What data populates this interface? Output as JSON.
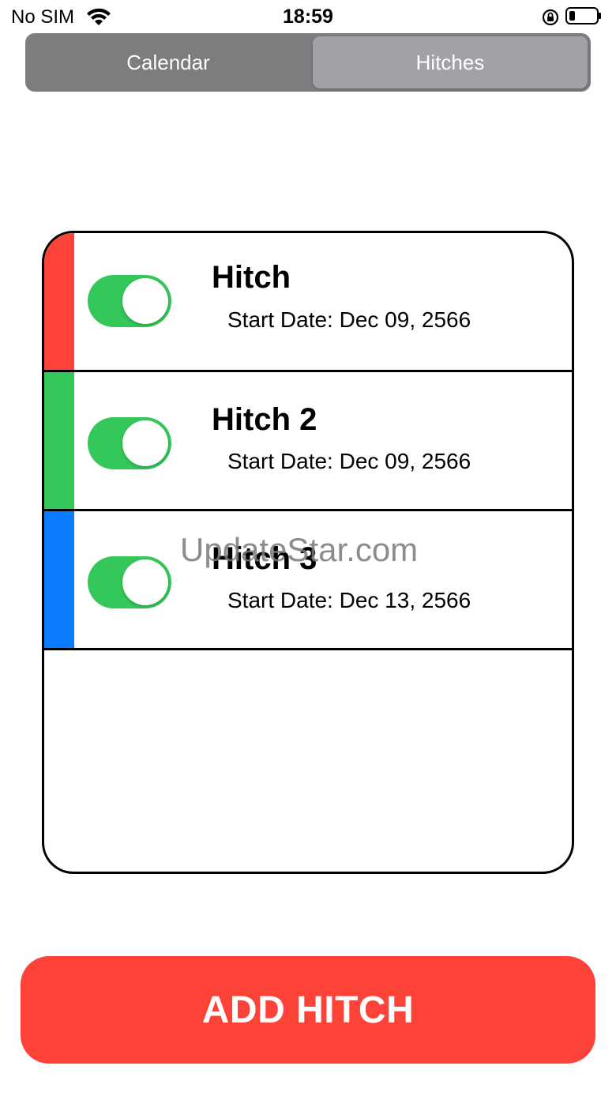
{
  "status_bar": {
    "carrier": "No SIM",
    "time": "18:59",
    "wifi_icon": "wifi-icon",
    "rotation_lock_icon": "rotation-lock-icon",
    "battery_icon": "battery-icon"
  },
  "tabs": [
    {
      "label": "Calendar",
      "selected": false
    },
    {
      "label": "Hitches",
      "selected": true
    }
  ],
  "hitches": [
    {
      "title": "Hitch",
      "start_date": "Start Date: Dec 09, 2566",
      "color": "#fd4237",
      "enabled": true
    },
    {
      "title": "Hitch 2",
      "start_date": "Start Date: Dec 09, 2566",
      "color": "#34c759",
      "enabled": true
    },
    {
      "title": "Hitch 3",
      "start_date": "Start Date: Dec 13, 2566",
      "color": "#0a7cff",
      "enabled": true
    }
  ],
  "toggle_on_color": "#34c759",
  "watermark": "UpdateStar.com",
  "add_button": {
    "label": "ADD HITCH",
    "color": "#fd4237"
  }
}
